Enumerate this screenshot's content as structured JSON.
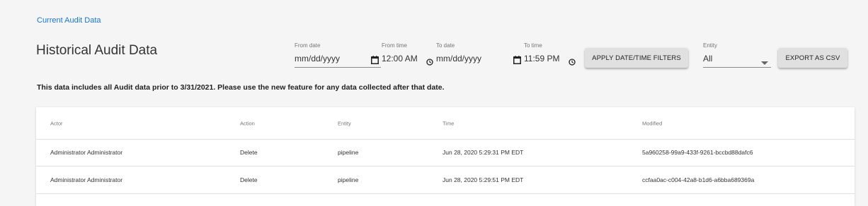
{
  "breadcrumb": "Current Audit Data",
  "page_title": "Historical Audit Data",
  "filters": {
    "from_date": {
      "label": "From date",
      "value": "mm/dd/yyyy"
    },
    "from_time": {
      "label": "From time",
      "value": "12:00 AM"
    },
    "to_date": {
      "label": "To date",
      "value": "mm/dd/yyyy"
    },
    "to_time": {
      "label": "To time",
      "value": "11:59 PM"
    },
    "apply_label": "APPLY DATE/TIME FILTERS",
    "entity": {
      "label": "Entity",
      "value": "All"
    },
    "export_label": "EXPORT AS CSV"
  },
  "notice": "This data includes all Audit data prior to 3/31/2021. Please use the new feature for any data collected after that date.",
  "table": {
    "columns": [
      "Actor",
      "Action",
      "Entity",
      "Time",
      "Modified"
    ],
    "rows": [
      [
        "Administrator Administrator",
        "Delete",
        "pipeline",
        "Jun 28, 2020 5:29:31 PM EDT",
        "5a960258-99a9-433f-9261-bccbd88dafc6"
      ],
      [
        "Administrator Administrator",
        "Delete",
        "pipeline",
        "Jun 28, 2020 5:29:51 PM EDT",
        "ccfaa0ac-c004-42a8-b1d6-a6bba689369a"
      ]
    ]
  },
  "colors": {
    "link": "#1976d2",
    "button_bg": "#e0e0e0",
    "page_bg": "#f5f5f5"
  }
}
